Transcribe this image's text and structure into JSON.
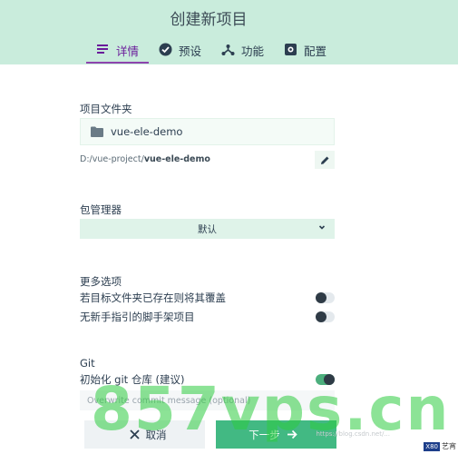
{
  "header": {
    "title": "创建新项目",
    "tabs": [
      {
        "label": "详情",
        "icon": "list-icon",
        "active": true
      },
      {
        "label": "预设",
        "icon": "check-circle-icon",
        "active": false
      },
      {
        "label": "功能",
        "icon": "feature-tree-icon",
        "active": false
      },
      {
        "label": "配置",
        "icon": "settings-icon",
        "active": false
      }
    ],
    "accent_color": "#8e44ad",
    "background_color": "#c9ecdc"
  },
  "folder": {
    "section_label": "项目文件夹",
    "name": "vue-ele-demo",
    "path_prefix": "D:/vue-project/",
    "path_name": "vue-ele-demo"
  },
  "package_manager": {
    "section_label": "包管理器",
    "selected": "默认"
  },
  "more_options": {
    "section_label": "更多选项",
    "options": [
      {
        "label": "若目标文件夹已存在则将其覆盖",
        "enabled": false
      },
      {
        "label": "无新手指引的脚手架项目",
        "enabled": false
      }
    ]
  },
  "git": {
    "section_label": "Git",
    "init_label": "初始化 git 仓库 (建议)",
    "init_enabled": true,
    "commit_placeholder": "Overwrite commit message (optional)"
  },
  "buttons": {
    "cancel_label": "取消",
    "next_label": "下一步"
  },
  "overlay": {
    "watermark_text": "857vps.cn",
    "badge_box": "X80",
    "badge_text": "艺宵",
    "faint_text": "https://blog.csdn.net/..."
  },
  "colors": {
    "primary_green": "#42b983",
    "toggle_off": "#e4e9ed"
  }
}
